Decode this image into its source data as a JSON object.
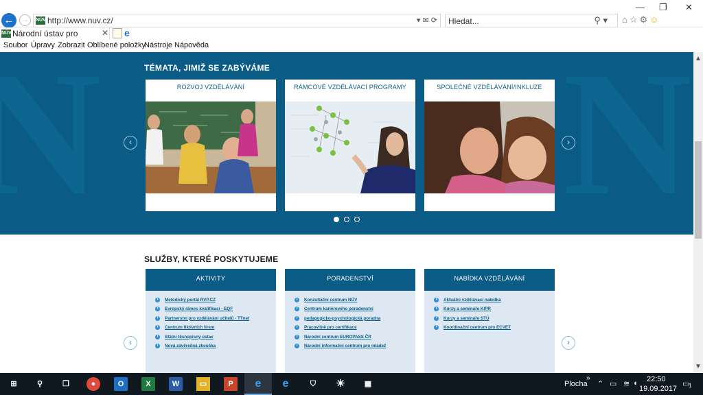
{
  "browser": {
    "url": "http://www.nuv.cz/",
    "search_placeholder": "Hledat...",
    "tab_title": "Národní ústav pro vzdělávání",
    "favicon_text": "NÚV",
    "menu": [
      "Soubor",
      "Úpravy",
      "Zobrazit",
      "Oblíbené položky",
      "Nástroje",
      "Nápověda"
    ]
  },
  "topics": {
    "title": "TÉMATA, JIMIŽ SE ZABÝVÁME",
    "cards": [
      {
        "title": "ROZVOJ VZDĚLÁVÁNÍ"
      },
      {
        "title": "RÁMCOVÉ VZDĚLÁVACÍ PROGRAMY"
      },
      {
        "title": "SPOLEČNÉ VZDĚLÁVÁNÍ/INKLUZE"
      }
    ]
  },
  "services": {
    "title": "SLUŽBY, KTERÉ POSKYTUJEME",
    "columns": [
      {
        "title": "AKTIVITY",
        "items": [
          "Metodický portál RVP.CZ",
          "Evropský rámec kvalifikací - EQF",
          "Partnerství pro vzdělávání učitelů - TTnet",
          "Centrum fiktivních firem",
          "Státní těsnopisný ústav",
          "Nová závěrečná zkouška"
        ]
      },
      {
        "title": "PORADENSTVÍ",
        "items": [
          "Konzultační centrum NÚV",
          "Centrum kariérového poradenství",
          "pedagogicko-psychologická poradna",
          "Pracoviště pro certifikace",
          "Národní centrum EUROPASS ČR",
          "Národní informační centrum pro mládež"
        ]
      },
      {
        "title": "NABÍDKA VZDĚLÁVÁNÍ",
        "items": [
          "Aktuální vzdělávací nabídka",
          "Kurzy a semináře KIPR",
          "Kurzy a semináře STÚ",
          "Koordinační centrum pro ECVET"
        ]
      }
    ]
  },
  "taskbar": {
    "desktop_label": "Plocha",
    "time": "22:50",
    "date": "19.09.2017",
    "notification_count": "1"
  },
  "colors": {
    "brand_blue": "#0a5c86",
    "light_panel": "#dde8f2",
    "taskbar": "#101820"
  }
}
